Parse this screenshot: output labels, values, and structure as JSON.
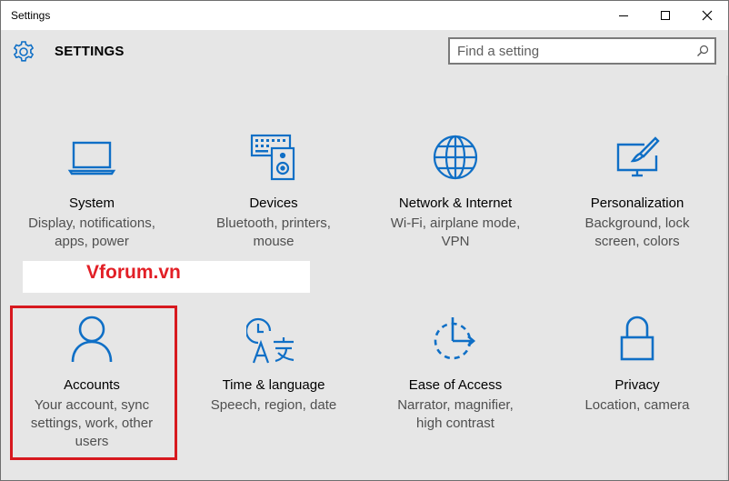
{
  "window": {
    "title": "Settings"
  },
  "header": {
    "title": "SETTINGS"
  },
  "search": {
    "placeholder": "Find a setting"
  },
  "watermark": {
    "text": "Vforum.vn"
  },
  "accent": "#0f6fc6",
  "tiles": [
    {
      "icon": "laptop-icon",
      "title": "System",
      "desc1": "Display, notifications,",
      "desc2": "apps, power",
      "desc3": ""
    },
    {
      "icon": "keyboard-speaker-icon",
      "title": "Devices",
      "desc1": "Bluetooth, printers,",
      "desc2": "mouse",
      "desc3": ""
    },
    {
      "icon": "globe-icon",
      "title": "Network & Internet",
      "desc1": "Wi-Fi, airplane mode,",
      "desc2": "VPN",
      "desc3": ""
    },
    {
      "icon": "paint-monitor-icon",
      "title": "Personalization",
      "desc1": "Background, lock",
      "desc2": "screen, colors",
      "desc3": ""
    },
    {
      "icon": "person-icon",
      "title": "Accounts",
      "desc1": "Your account, sync",
      "desc2": "settings, work, other",
      "desc3": "users"
    },
    {
      "icon": "clock-language-icon",
      "title": "Time & language",
      "desc1": "Speech, region, date",
      "desc2": "",
      "desc3": ""
    },
    {
      "icon": "ease-of-access-icon",
      "title": "Ease of Access",
      "desc1": "Narrator, magnifier,",
      "desc2": "high contrast",
      "desc3": ""
    },
    {
      "icon": "lock-icon",
      "title": "Privacy",
      "desc1": "Location, camera",
      "desc2": "",
      "desc3": ""
    }
  ]
}
